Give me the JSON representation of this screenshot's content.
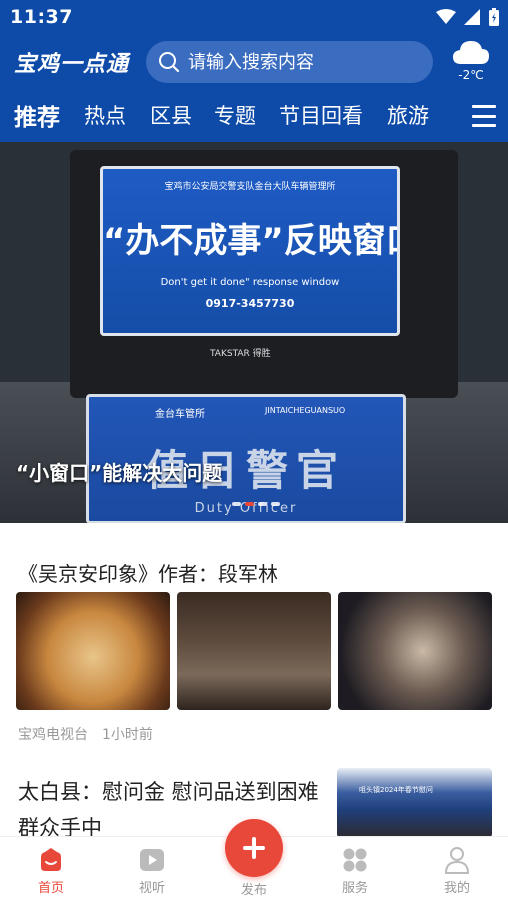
{
  "status_bar": {
    "time": "11:37"
  },
  "header": {
    "logo_text": "宝鸡一点通",
    "search_placeholder": "请输入搜索内容",
    "weather": {
      "icon": "cloud-icon",
      "temperature": "-2℃"
    }
  },
  "tabs": [
    "推荐",
    "热点",
    "区县",
    "专题",
    "节目回看",
    "旅游"
  ],
  "active_tab": "推荐",
  "banner": {
    "caption": "“小窗口”能解决大问题",
    "slide_count": 4,
    "active_slide": 2,
    "photo_sign": {
      "org": "宝鸡市公安局交警支队金台大队车辆管理所",
      "headline": "“办不成事”反映窗口",
      "english": "Don't get it done\" response window",
      "phone": "0917-3457730",
      "station": "金台车管所",
      "station_en": "JINTAICHEGUANSUO",
      "duty_cn": "值日警官",
      "duty_en": "Duty Officer",
      "brand": "TAKSTAR 得胜"
    }
  },
  "articles": [
    {
      "title": "《吴京安印象》作者：段军林",
      "source": "宝鸡电视台",
      "time": "1小时前"
    },
    {
      "title": "太白县：慰问金 慰问品送到困难群众手中",
      "thumb_banner": "咀头镇2024年春节慰问"
    }
  ],
  "bottom_nav": [
    {
      "label": "首页",
      "icon": "home-icon"
    },
    {
      "label": "视听",
      "icon": "play-icon"
    },
    {
      "label": "发布",
      "icon": "plus-icon"
    },
    {
      "label": "服务",
      "icon": "grid-icon"
    },
    {
      "label": "我的",
      "icon": "user-icon"
    }
  ],
  "colors": {
    "header": "#0e4aa8",
    "accent": "#e8483a"
  }
}
